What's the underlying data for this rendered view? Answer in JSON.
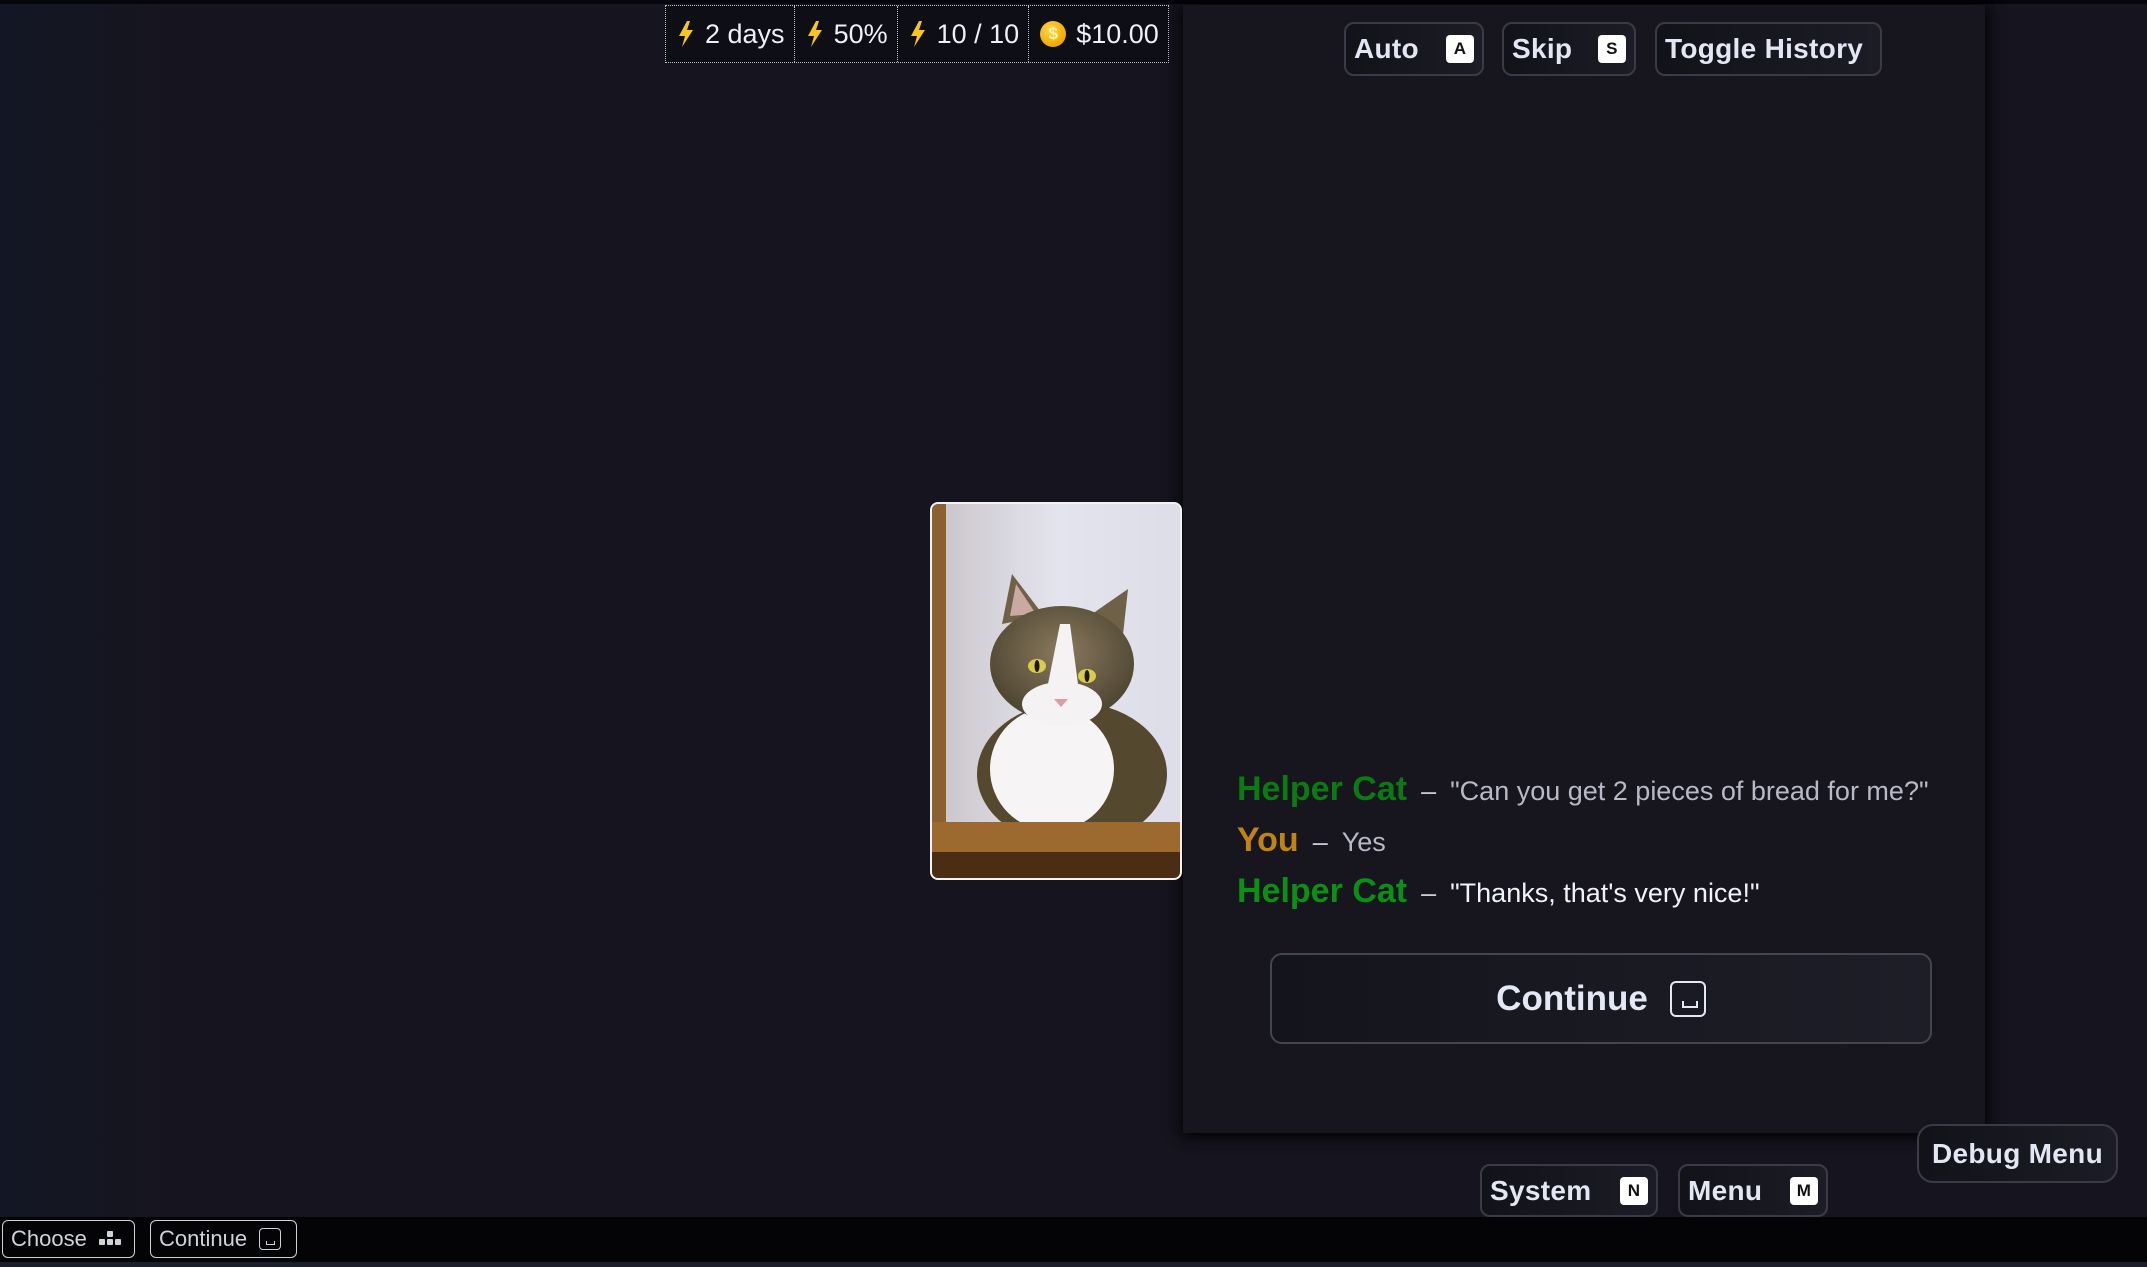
{
  "stats": [
    {
      "icon": "lightning-bolt-icon",
      "value": "2 days"
    },
    {
      "icon": "lightning-bolt-icon",
      "value": "50%"
    },
    {
      "icon": "lightning-bolt-icon",
      "value": "10 / 10"
    },
    {
      "icon": "coin-icon",
      "value": "$10.00"
    }
  ],
  "controls": {
    "auto": {
      "label": "Auto",
      "key": "A"
    },
    "skip": {
      "label": "Skip",
      "key": "S"
    },
    "toggle_history": {
      "label": "Toggle History"
    }
  },
  "portrait": {
    "subject": "tabby and white cat"
  },
  "dialogue": [
    {
      "speaker": "Helper Cat",
      "speaker_color": "#0b7a12",
      "separator": "–",
      "text": "\"Can you get 2 pieces of bread for me?\"",
      "state": "past"
    },
    {
      "speaker": "You",
      "speaker_color": "#c08415",
      "separator": "–",
      "text": "Yes",
      "state": "past"
    },
    {
      "speaker": "Helper Cat",
      "speaker_color": "#0b8f14",
      "separator": "–",
      "text": "\"Thanks, that's very nice!\"",
      "state": "current"
    }
  ],
  "continue_button": {
    "label": "Continue",
    "key_icon": "space-key-icon"
  },
  "debug_menu": {
    "label": "Debug Menu"
  },
  "system_button": {
    "label": "System",
    "key": "N"
  },
  "menu_button": {
    "label": "Menu",
    "key": "M"
  },
  "bottom_bar": {
    "choose": {
      "label": "Choose",
      "icon": "choices-icon"
    },
    "continue": {
      "label": "Continue",
      "icon": "space-key-icon"
    }
  }
}
